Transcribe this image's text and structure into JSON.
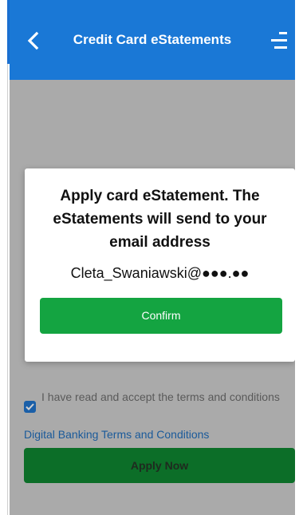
{
  "header": {
    "title": "Credit Card eStatements",
    "back_icon": "chevron-left-icon",
    "menu_icon": "menu-icon",
    "background_color": "#1a78d6"
  },
  "form": {
    "terms_checked": true,
    "terms_label": "I have read and accept the terms and conditions",
    "terms_link": "Digital Banking Terms and Conditions",
    "apply_label": "Apply Now"
  },
  "modal": {
    "message": "Apply card eStatement. The eStatements will send to your email address",
    "email": "Cleta_Swaniawski@●●●.●●",
    "confirm_label": "Confirm",
    "confirm_color": "#14a441"
  }
}
